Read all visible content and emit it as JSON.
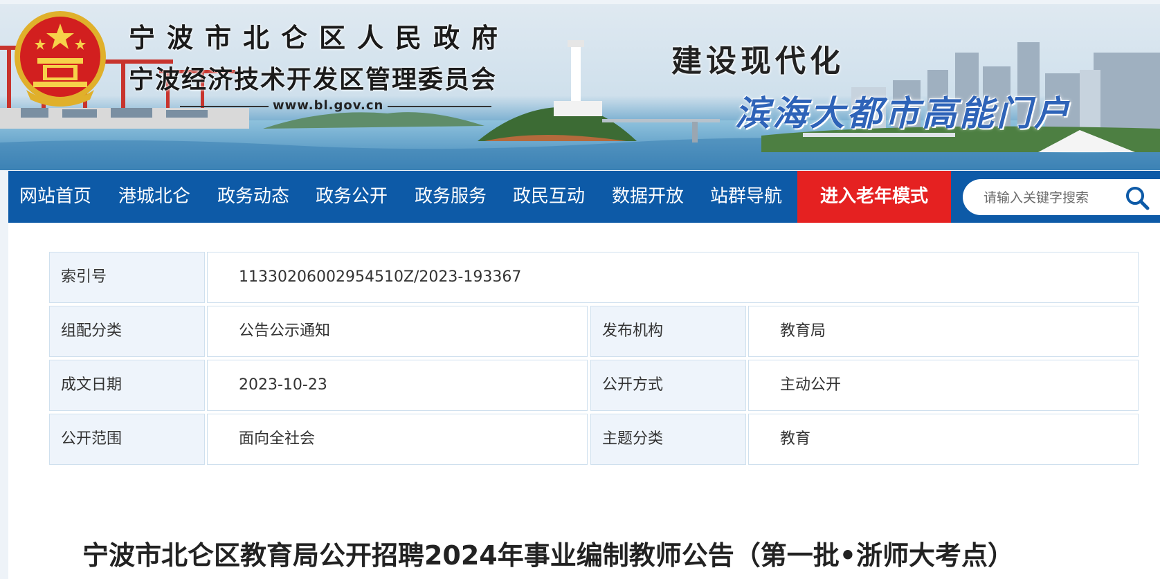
{
  "header": {
    "title_line1": "宁波市北仑区人民政府",
    "title_line2": "宁波经济技术开发区管理委员会",
    "url": "www.bl.gov.cn",
    "slogan1": "建设现代化",
    "slogan2": "滨海大都市高能门户"
  },
  "nav": {
    "items": [
      "网站首页",
      "港城北仑",
      "政务动态",
      "政务公开",
      "政务服务",
      "政民互动",
      "数据开放",
      "站群导航"
    ],
    "elder_mode": "进入老年模式",
    "search_placeholder": "请输入关键字搜索"
  },
  "meta": {
    "index_label": "索引号",
    "index_value": "11330206002954510Z/2023-193367",
    "category_label": "组配分类",
    "category_value": "公告公示通知",
    "publisher_label": "发布机构",
    "publisher_value": "教育局",
    "date_label": "成文日期",
    "date_value": "2023-10-23",
    "openmode_label": "公开方式",
    "openmode_value": "主动公开",
    "scope_label": "公开范围",
    "scope_value": "面向全社会",
    "topic_label": "主题分类",
    "topic_value": "教育"
  },
  "article": {
    "title": "宁波市北仑区教育局公开招聘2024年事业编制教师公告（第一批•浙师大考点）"
  },
  "colors": {
    "nav_bg": "#0d5aa7",
    "elder_bg": "#e52121",
    "label_bg": "#eef4fb",
    "border": "#cfe0ee",
    "slogan_blue": "#2e63b8"
  },
  "icons": {
    "emblem": "national-emblem",
    "search": "search-icon"
  }
}
